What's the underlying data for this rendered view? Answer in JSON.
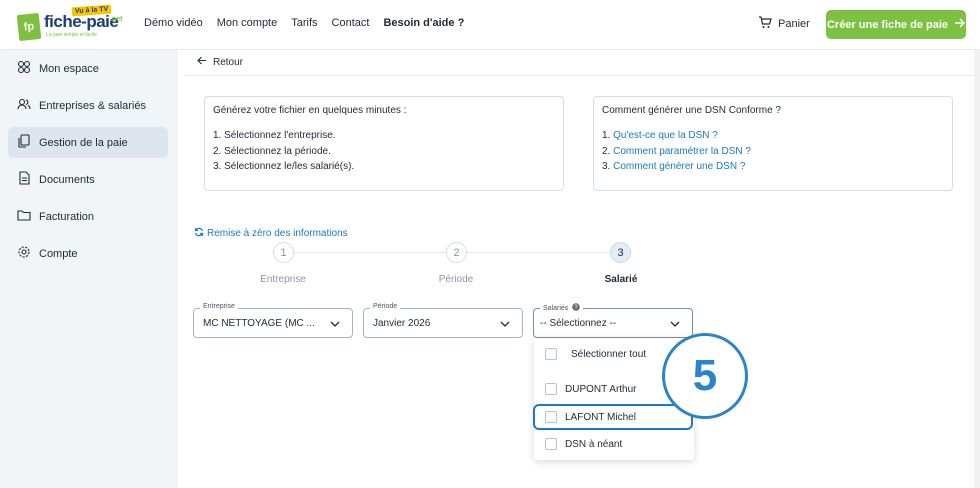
{
  "header": {
    "logo": {
      "brand": "fiche-paie",
      "tv": "Vu à la TV",
      "net": ".net",
      "tagline": "La paie simple et facile",
      "mark": "fp"
    },
    "nav": [
      "Démo vidéo",
      "Mon compte",
      "Tarifs",
      "Contact",
      "Besoin d'aide ?"
    ],
    "cart_label": "Panier",
    "cta_label": "Créer une fiche de paie",
    "cta_color": "#7cc142"
  },
  "sidebar": {
    "items": [
      {
        "label": "Mon espace",
        "icon": "grid-icon",
        "active": false
      },
      {
        "label": "Entreprises & salariés",
        "icon": "users-icon",
        "active": false
      },
      {
        "label": "Gestion de la paie",
        "icon": "documents-copy-icon",
        "active": true
      },
      {
        "label": "Documents",
        "icon": "document-icon",
        "active": false
      },
      {
        "label": "Facturation",
        "icon": "folder-icon",
        "active": false
      },
      {
        "label": "Compte",
        "icon": "gear-icon",
        "active": false
      }
    ]
  },
  "main": {
    "back_label": "Retour",
    "info_left": {
      "title": "Générez votre fichier en quelques minutes :",
      "lines": [
        "1. Sélectionnez l'entreprise.",
        "2. Sélectionnez la période.",
        "3. Sélectionnez le/les salarié(s)."
      ]
    },
    "info_right": {
      "title": "Comment générer une DSN Conforme ?",
      "lines": [
        {
          "num": "1.",
          "link": "Qu'est-ce que la DSN ?"
        },
        {
          "num": "2.",
          "link": "Comment paramétrer la DSN ?"
        },
        {
          "num": "3.",
          "link": "Comment générer une DSN ?"
        }
      ]
    },
    "reset_label": "Remise à zéro des informations",
    "steps": [
      {
        "num": "1",
        "label": "Entreprise",
        "active": false
      },
      {
        "num": "2",
        "label": "Période",
        "active": false
      },
      {
        "num": "3",
        "label": "Salarié",
        "active": true
      }
    ],
    "selects": {
      "entreprise": {
        "label": "Entreprise",
        "value": "MC NETTOYAGE (MC ..."
      },
      "periode": {
        "label": "Période",
        "value": "Janvier 2026"
      },
      "salaries": {
        "label": "Salariés",
        "value": "-- Sélectionnez --"
      }
    },
    "dropdown": {
      "select_all": "Sélectionner tout",
      "options": [
        "DUPONT Arthur",
        "LAFONT Michel",
        "DSN à néant"
      ],
      "highlighted": "LAFONT Michel"
    },
    "annotation_number": "5",
    "accent_color": "#1a7ac1"
  }
}
